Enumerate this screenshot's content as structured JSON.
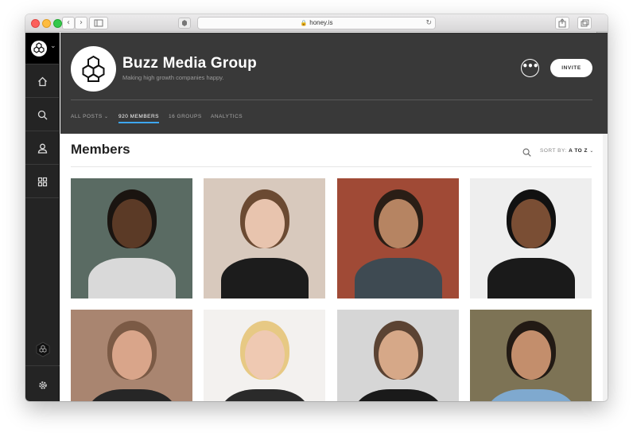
{
  "browser": {
    "url": "honey.is",
    "lock_icon": "lock-icon"
  },
  "group": {
    "name": "Buzz Media Group",
    "tagline": "Making high growth companies happy.",
    "more_label": "•••",
    "invite_label": "INVITE"
  },
  "tabs": [
    {
      "label": "ALL POSTS",
      "active": false,
      "has_caret": true
    },
    {
      "label": "920 MEMBERS",
      "active": true
    },
    {
      "label": "16 GROUPS",
      "active": false
    },
    {
      "label": "ANALYTICS",
      "active": false
    }
  ],
  "members": {
    "title": "Members",
    "sort_prefix": "SORT BY:",
    "sort_value": "A TO Z",
    "cards": [
      {
        "photo": "member-photo-1",
        "bg": "#5a6b63",
        "skin": "#5b3a26",
        "hair": "#1a1410",
        "shirt": "#d9d9d9"
      },
      {
        "photo": "member-photo-2",
        "bg": "#d8c9bd",
        "skin": "#e8c4ae",
        "hair": "#6b4a32",
        "shirt": "#1c1c1c"
      },
      {
        "photo": "member-photo-3",
        "bg": "#a04a36",
        "skin": "#b68462",
        "hair": "#2a1e16",
        "shirt": "#3e4a52"
      },
      {
        "photo": "member-photo-4",
        "bg": "#eeeeee",
        "skin": "#7a4e34",
        "hair": "#111111",
        "shirt": "#1a1a1a"
      },
      {
        "photo": "member-photo-5",
        "bg": "#a98570",
        "skin": "#d9a58a",
        "hair": "#7b5a45",
        "shirt": "#262626"
      },
      {
        "photo": "member-photo-6",
        "bg": "#f3f1ef",
        "skin": "#efc9b2",
        "hair": "#e7c984",
        "shirt": "#2a2a2a"
      },
      {
        "photo": "member-photo-7",
        "bg": "#d6d6d6",
        "skin": "#d6a888",
        "hair": "#5b4333",
        "shirt": "#1a1a1a"
      },
      {
        "photo": "member-photo-8",
        "bg": "#7d7355",
        "skin": "#c38e6c",
        "hair": "#221a14",
        "shirt": "#7fa9cf"
      }
    ]
  }
}
